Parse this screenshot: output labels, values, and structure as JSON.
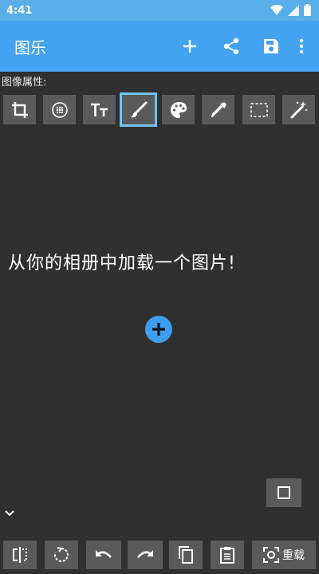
{
  "status_bar": {
    "time": "4:41",
    "icons": [
      "wifi-icon",
      "signal-icon",
      "battery-icon"
    ]
  },
  "app_bar": {
    "title": "图乐",
    "actions": [
      "add-icon",
      "share-icon",
      "save-icon",
      "more-vert-icon"
    ]
  },
  "image_props": {
    "label": "图像属性:",
    "tools": [
      "crop-icon",
      "grid-circle-icon",
      "text-size-icon",
      "brush-icon",
      "palette-icon",
      "eyedropper-icon",
      "selection-icon",
      "magic-wand-icon"
    ],
    "selected_tool": "brush-icon"
  },
  "canvas": {
    "prompt": "从你的相册中加载一个图片!",
    "load_icon": "add-circle-icon"
  },
  "bottom_toolbar": {
    "buttons": [
      "flip-icon",
      "rotate-icon",
      "undo-icon",
      "redo-icon",
      "copy-icon",
      "paste-icon"
    ],
    "reload_label": "重载",
    "reload_icon": "screen-capture-icon"
  },
  "colors": {
    "status_bar": "#5aaee8",
    "app_bar": "#43a3f0",
    "background": "#303030",
    "button": "#5a5a5a",
    "selected_border": "#6fc4f5",
    "accent": "#3d9ef0"
  }
}
